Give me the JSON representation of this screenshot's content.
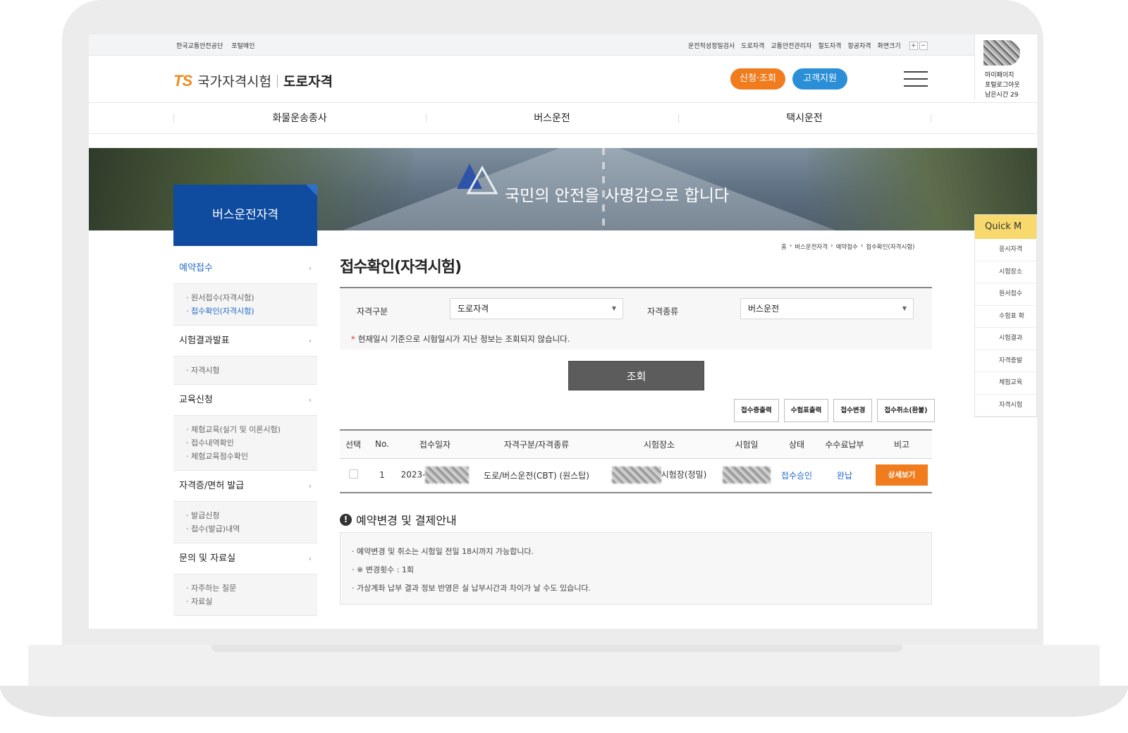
{
  "utility": {
    "left": [
      "한국교통안전공단",
      "포털메인"
    ],
    "right": [
      "운전적성정밀검사",
      "도로자격",
      "교통안전관리자",
      "철도자격",
      "항공자격",
      "화면크기"
    ],
    "fontsize_plus": "+",
    "fontsize_minus": "−"
  },
  "header": {
    "logo_ts": "TS",
    "logo_text": "국가자격시험",
    "logo_sub": "도로자격",
    "apply_label": "신청·조회",
    "support_label": "고객지원"
  },
  "login": {
    "mypage": "마이페이지",
    "logout": "포털로그아웃",
    "remaining": "남은시간 29"
  },
  "gnb": [
    "화물운송종사",
    "버스운전",
    "택시운전"
  ],
  "banner": {
    "slogan": "국민의 안전을 사명감으로 합니다"
  },
  "side_title": "버스운전자격",
  "lnb": [
    {
      "label": "예약접수",
      "active": true,
      "subs": [
        "원서접수(자격시험)",
        "접수확인(자격시험)"
      ],
      "sub_on": 1
    },
    {
      "label": "시험결과발표",
      "subs": [
        "자격시험"
      ]
    },
    {
      "label": "교육신청",
      "subs": [
        "체험교육(실기 및 이론시험)",
        "접수내역확인",
        "체험교육점수확인"
      ]
    },
    {
      "label": "자격증/면허 발급",
      "subs": [
        "발급신청",
        "접수(발급)내역"
      ]
    },
    {
      "label": "문의 및 자료실",
      "subs": [
        "자주하는 질문",
        "자료실"
      ]
    }
  ],
  "breadcrumb": [
    "홈",
    "버스운전자격",
    "예약접수",
    "접수확인(자격시험)"
  ],
  "page_title": "접수확인(자격시험)",
  "search": {
    "label_type": "자격구분",
    "value_type": "도로자격",
    "label_kind": "자격종류",
    "value_kind": "버스운전",
    "note_mark": "*",
    "note": "현재일시 기준으로 시험일시가 지난 정보는 조회되지 않습니다.",
    "search_button": "조회"
  },
  "actions": [
    "접수증출력",
    "수험표출력",
    "접수변경",
    "접수취소(환불)"
  ],
  "table": {
    "headers": [
      "선택",
      "No.",
      "접수일자",
      "자격구분/자격종류",
      "시험장소",
      "시험일",
      "상태",
      "수수료납부",
      "비고"
    ],
    "row": {
      "no": "1",
      "date_prefix": "2023-",
      "type": "도로/버스운전(CBT) (원스탑)",
      "place_suffix": "시험장(정밀)",
      "status": "접수승인",
      "fee": "완납",
      "detail": "상세보기"
    }
  },
  "notice": {
    "title": "예약변경 및 결제안내",
    "icon": "!",
    "lines": [
      "· 예약변경 및 취소는 시험일 전일 18시까지 가능합니다.",
      "· ※ 변경횟수 : 1회",
      "· 가상계좌 납부 결과 정보 반영은 실 납부시간과 차이가 날 수도 있습니다."
    ]
  },
  "quick": {
    "head": "Quick M",
    "items": [
      "응시자격",
      "시험장소",
      "원서접수",
      "수험표 확",
      "시험결과",
      "자격증발",
      "체험교육",
      "자격시험"
    ]
  }
}
